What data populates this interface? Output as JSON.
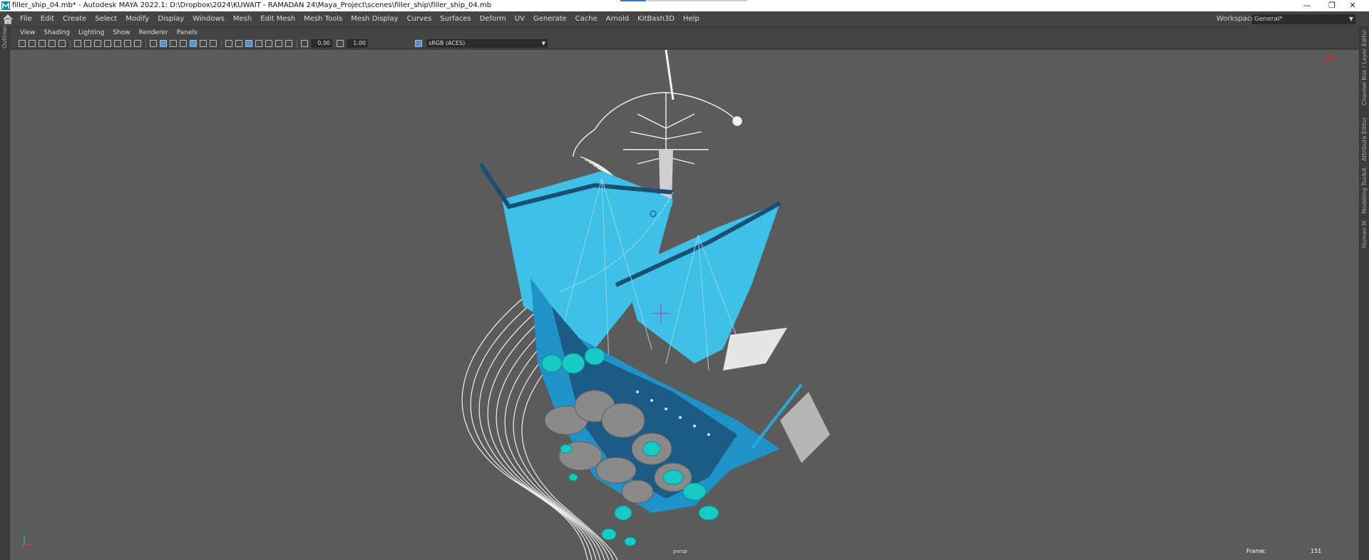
{
  "title_bar": {
    "text": "filler_ship_04.mb* - Autodesk MAYA 2022.1: D:\\Dropbox\\2024\\KUWAIT - RAMADAN 24\\Maya_Project\\scenes\\filler_ship\\filler_ship_04.mb",
    "app_icon": "maya-icon",
    "minimize_glyph": "—",
    "restore_glyph": "❐",
    "close_glyph": "✕"
  },
  "menu_bar": {
    "items": [
      "File",
      "Edit",
      "Create",
      "Select",
      "Modify",
      "Display",
      "Windows",
      "Mesh",
      "Edit Mesh",
      "Mesh Tools",
      "Mesh Display",
      "Curves",
      "Surfaces",
      "Deform",
      "UV",
      "Generate",
      "Cache",
      "Arnold",
      "KitBash3D",
      "Help"
    ],
    "workspace_label": "Workspace:",
    "workspace_value": "General*",
    "home_icon": "home-icon"
  },
  "left_strip": {
    "label": "Outliner"
  },
  "right_strip": {
    "labels": [
      "Channel Box / Layer Editor",
      "Attribute Editor",
      "Modeling Toolkit",
      "Human IK"
    ]
  },
  "panel_menu": {
    "items": [
      "View",
      "Shading",
      "Lighting",
      "Show",
      "Renderer",
      "Panels"
    ]
  },
  "panel_toolbar": {
    "exposure_value": "0.00",
    "gamma_value": "1.00",
    "color_space": "sRGB (ACES)"
  },
  "viewport": {
    "camera_name": "persp",
    "frame_label": "Frame:",
    "frame_value": "151",
    "colors": {
      "background": "#5b5b5b",
      "hull_blue": "#1f93c8",
      "sail_cyan": "#3fc0e6",
      "dark_hull": "#20557a",
      "teal_foam": "#19c9c4",
      "gray_rock": "#8a8a8a",
      "wire_white": "#f0f0f0"
    }
  }
}
